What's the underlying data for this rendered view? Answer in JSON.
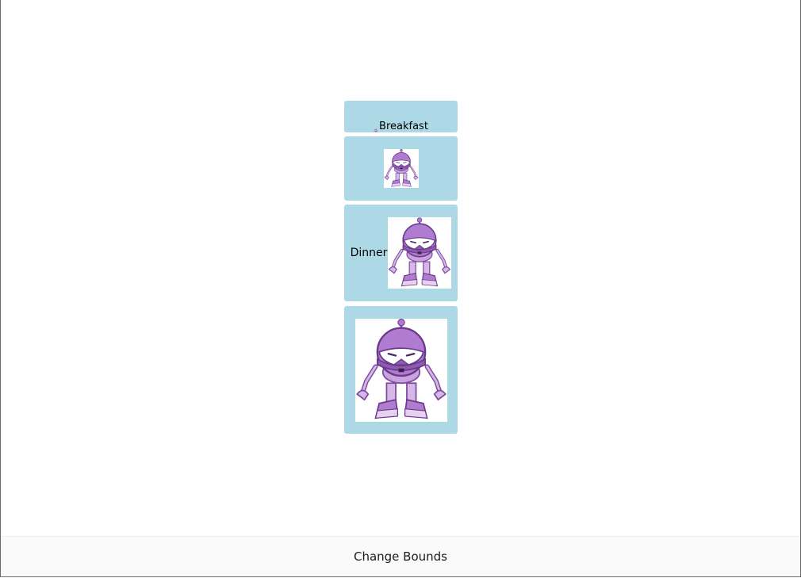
{
  "buttons": [
    {
      "label": "Breakfast",
      "image": "robot-icon"
    },
    {
      "label": "",
      "image": "robot-icon"
    },
    {
      "label": "Dinner",
      "image": "robot-icon"
    },
    {
      "label": "",
      "image": "robot-icon"
    }
  ],
  "footer": {
    "change_bounds_label": "Change Bounds"
  },
  "colors": {
    "button_bg": "#add8e6",
    "robot_purple": "#9b59b6"
  }
}
